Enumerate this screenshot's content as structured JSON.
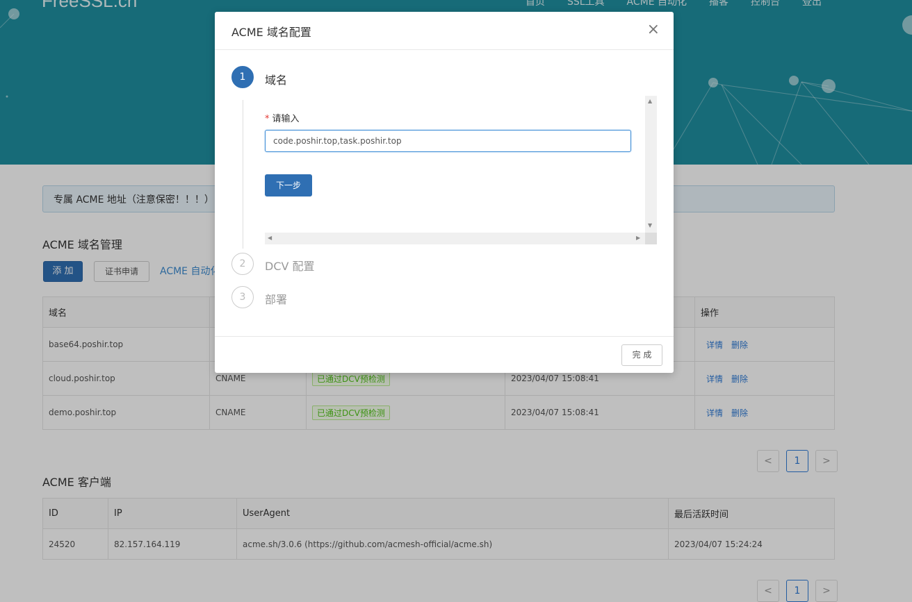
{
  "header": {
    "brand": "FreeSSL.cn",
    "nav": [
      "首页",
      "SSL工具",
      "ACME 自动化",
      "播客",
      "控制台",
      "登出"
    ]
  },
  "acme_notice": "专属 ACME 地址（注意保密！！！）",
  "domains_section": {
    "title": "ACME 域名管理",
    "add_label": "添 加",
    "cert_label": "证书申请",
    "auto_link": "ACME 自动化",
    "columns": [
      "域名",
      "",
      "",
      "",
      "操作"
    ],
    "rows": [
      {
        "domain": "base64.poshir.top",
        "type": "",
        "status": "",
        "time": "",
        "detail": "详情",
        "delete": "删除"
      },
      {
        "domain": "cloud.poshir.top",
        "type": "CNAME",
        "status": "已通过DCV预检测",
        "time": "2023/04/07 15:08:41",
        "detail": "详情",
        "delete": "删除"
      },
      {
        "domain": "demo.poshir.top",
        "type": "CNAME",
        "status": "已通过DCV预检测",
        "time": "2023/04/07 15:08:41",
        "detail": "详情",
        "delete": "删除"
      }
    ],
    "pager": {
      "prev": "<",
      "page": "1",
      "next": ">"
    }
  },
  "clients_section": {
    "title": "ACME 客户端",
    "columns": [
      "ID",
      "IP",
      "UserAgent",
      "最后活跃时间"
    ],
    "rows": [
      {
        "id": "24520",
        "ip": "82.157.164.119",
        "ua": "acme.sh/3.0.6 (https://github.com/acmesh-official/acme.sh)",
        "last": "2023/04/07 15:24:24"
      }
    ],
    "pager": {
      "prev": "<",
      "page": "1",
      "next": ">"
    }
  },
  "modal": {
    "title": "ACME 域名配置",
    "close": "×",
    "steps": [
      {
        "num": "1",
        "title": "域名"
      },
      {
        "num": "2",
        "title": "DCV 配置"
      },
      {
        "num": "3",
        "title": "部署"
      }
    ],
    "required_mark": "*",
    "field_label": "请输入",
    "field_value": "code.poshir.top,task.poshir.top",
    "next_label": "下一步",
    "finish_label": "完 成"
  },
  "colors": {
    "header_bg": "#1f8fa1",
    "primary": "#2f6fb3",
    "link": "#2f7bd6",
    "success": "#52c41a"
  }
}
